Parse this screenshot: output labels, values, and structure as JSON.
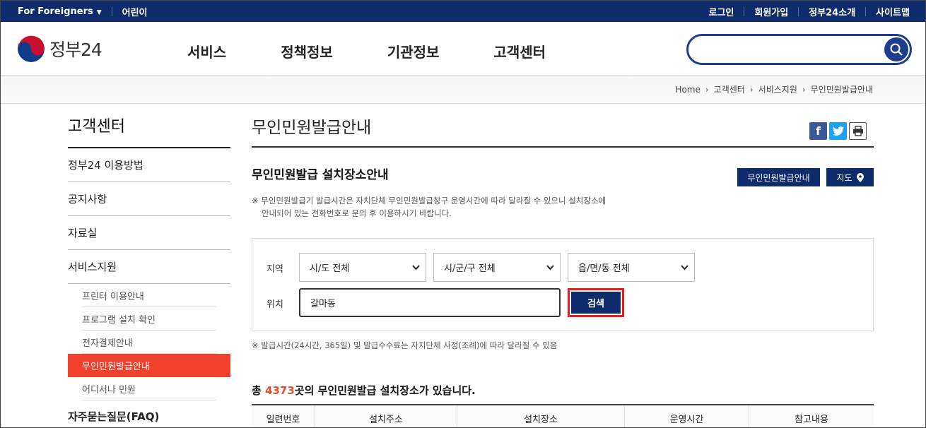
{
  "topbar": {
    "foreigners": "For Foreigners",
    "kids": "어린이",
    "login": "로그인",
    "signup": "회원가입",
    "about": "정부24소개",
    "sitemap": "사이트맵"
  },
  "header": {
    "logo": "정부24",
    "nav": [
      "서비스",
      "정책정보",
      "기관정보",
      "고객센터"
    ],
    "search_placeholder": ""
  },
  "breadcrumb": [
    "Home",
    "고객센터",
    "서비스지원",
    "무인민원발급안내"
  ],
  "sidebar": {
    "title": "고객센터",
    "items": [
      "정부24 이용방법",
      "공지사항",
      "자료실",
      "서비스지원"
    ],
    "subitems": [
      "프린터 이용안내",
      "프로그램 설치 확인",
      "전자결제안내",
      "무인민원발급안내",
      "어디서나 민원"
    ],
    "faq": "자주묻는질문(FAQ)"
  },
  "main": {
    "title": "무인민원발급안내",
    "section_title": "무인민원발급 설치장소안내",
    "btn_info": "무인민원발급안내",
    "btn_map": "지도",
    "note1_line1": "※ 무인민원발급기 발급시간은 자치단체 무인민원발급창구 운영시간에 따라 달라질 수 있으니 설치장소에",
    "note1_line2": "안내되어 있는 전화번호로 문의 후 이용하시기 바랍니다.",
    "region_label": "지역",
    "sido": "시/도 전체",
    "sigungu": "시/군/구 전체",
    "eupmyeon": "읍/면/동 전체",
    "location_label": "위치",
    "location_value": "갈마동",
    "search_btn": "검색",
    "note2": "※ 발급시간(24시간, 365일) 및 발급수수료는 자치단체 사정(조례)에 따라 달라질 수 있음",
    "count_prefix": "총 ",
    "count_value": "4373",
    "count_suffix": "곳의 무인민원발급 설치장소가 있습니다.",
    "table_headers": [
      "일련번호",
      "설치주소",
      "설치장소",
      "운영시간",
      "참고내용"
    ]
  },
  "colors": {
    "navy": "#0e2c6b",
    "accent_red": "#f2402b"
  }
}
